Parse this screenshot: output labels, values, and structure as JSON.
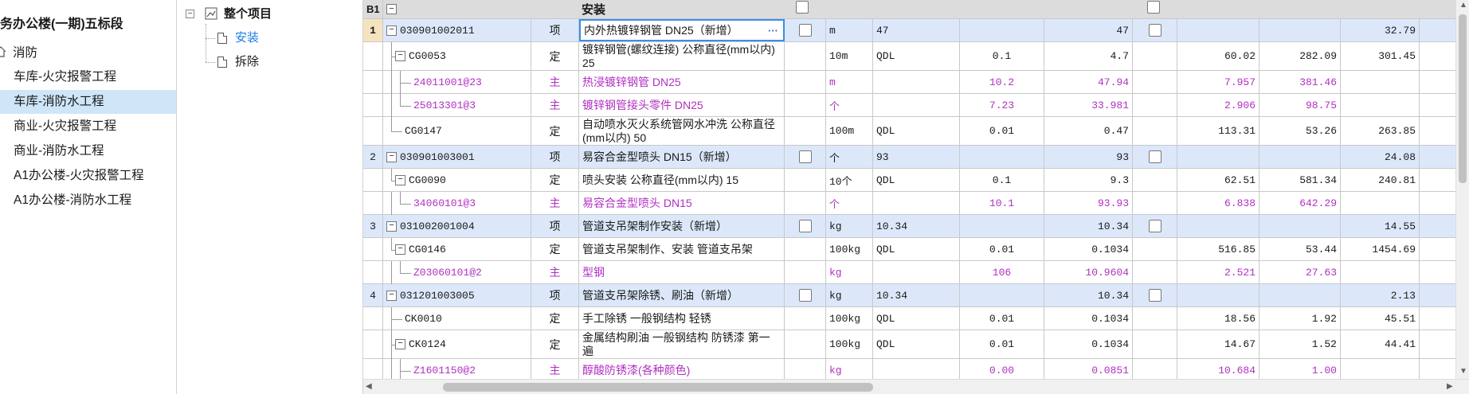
{
  "left_panel": {
    "project_title": "务办公楼(一期)五标段",
    "root": "消防",
    "items": [
      "车库-火灾报警工程",
      "车库-消防水工程",
      "商业-火灾报警工程",
      "商业-消防水工程",
      "A1办公楼-火灾报警工程",
      "A1办公楼-消防水工程"
    ],
    "selected_index": 1
  },
  "middle_panel": {
    "root": "整个项目",
    "children": [
      "安装",
      "拆除"
    ],
    "selected_index": 0,
    "expand_symbol": "−"
  },
  "grid": {
    "header": {
      "code": "B1",
      "name": "安装",
      "expand_symbol": "−"
    },
    "ellipsis": "···",
    "colors": {
      "accent_row": "#dce8fa",
      "header_bg": "#dcdcdc",
      "material_text": "#b030c0",
      "selected_tree": "#cfe6f8"
    },
    "rows": [
      {
        "idx": "1",
        "level": 0,
        "code": "030901002011",
        "type": "项",
        "name": "内外热镀锌钢管 DN25（新增）",
        "unit": "m",
        "expr": "47",
        "coef": "",
        "qty": "47",
        "p1": "",
        "p2": "",
        "p3": "32.79",
        "item": true,
        "hasBox": true,
        "selected": true
      },
      {
        "idx": "",
        "level": 1,
        "code": "CG0053",
        "type": "定",
        "name": "镀锌钢管(螺纹连接) 公称直径(mm以内) 25",
        "unit": "10m",
        "expr": "QDL",
        "coef": "0.1",
        "qty": "4.7",
        "p1": "60.02",
        "p2": "282.09",
        "p3": "301.45",
        "hasBox": true
      },
      {
        "idx": "",
        "level": 2,
        "code": "24011001@23",
        "type": "主",
        "name": "热浸镀锌钢管 DN25",
        "unit": "m",
        "expr": "",
        "coef": "10.2",
        "qty": "47.94",
        "p1": "7.957",
        "p2": "381.46",
        "p3": "",
        "mat": true
      },
      {
        "idx": "",
        "level": 2,
        "code": "25013301@3",
        "type": "主",
        "name": "镀锌钢管接头零件 DN25",
        "unit": "个",
        "expr": "",
        "coef": "7.23",
        "qty": "33.981",
        "p1": "2.906",
        "p2": "98.75",
        "p3": "",
        "mat": true,
        "last": true
      },
      {
        "idx": "",
        "level": 1,
        "code": "CG0147",
        "type": "定",
        "name": "自动喷水灭火系统管网水冲洗 公称直径(mm以内) 50",
        "unit": "100m",
        "expr": "QDL",
        "coef": "0.01",
        "qty": "0.47",
        "p1": "113.31",
        "p2": "53.26",
        "p3": "263.85",
        "last": true
      },
      {
        "idx": "2",
        "level": 0,
        "code": "030901003001",
        "type": "项",
        "name": "易容合金型喷头 DN15（新增）",
        "unit": "个",
        "expr": "93",
        "coef": "",
        "qty": "93",
        "p1": "",
        "p2": "",
        "p3": "24.08",
        "item": true,
        "hasBox": true
      },
      {
        "idx": "",
        "level": 1,
        "code": "CG0090",
        "type": "定",
        "name": "喷头安装 公称直径(mm以内) 15",
        "unit": "10个",
        "expr": "QDL",
        "coef": "0.1",
        "qty": "9.3",
        "p1": "62.51",
        "p2": "581.34",
        "p3": "240.81",
        "hasBox": true,
        "last": true
      },
      {
        "idx": "",
        "level": 2,
        "code": "34060101@3",
        "type": "主",
        "name": "易容合金型喷头 DN15",
        "unit": "个",
        "expr": "",
        "coef": "10.1",
        "qty": "93.93",
        "p1": "6.838",
        "p2": "642.29",
        "p3": "",
        "mat": true,
        "last": true
      },
      {
        "idx": "3",
        "level": 0,
        "code": "031002001004",
        "type": "项",
        "name": "管道支吊架制作安装（新增）",
        "unit": "kg",
        "expr": "10.34",
        "coef": "",
        "qty": "10.34",
        "p1": "",
        "p2": "",
        "p3": "14.55",
        "item": true,
        "hasBox": true
      },
      {
        "idx": "",
        "level": 1,
        "code": "CG0146",
        "type": "定",
        "name": "管道支吊架制作、安装 管道支吊架",
        "unit": "100kg",
        "expr": "QDL",
        "coef": "0.01",
        "qty": "0.1034",
        "p1": "516.85",
        "p2": "53.44",
        "p3": "1454.69",
        "hasBox": true,
        "last": true
      },
      {
        "idx": "",
        "level": 2,
        "code": "Z03060101@2",
        "type": "主",
        "name": "型钢",
        "unit": "kg",
        "expr": "",
        "coef": "106",
        "qty": "10.9604",
        "p1": "2.521",
        "p2": "27.63",
        "p3": "",
        "mat": true,
        "last": true
      },
      {
        "idx": "4",
        "level": 0,
        "code": "031201003005",
        "type": "项",
        "name": "管道支吊架除锈、刷油（新增）",
        "unit": "kg",
        "expr": "10.34",
        "coef": "",
        "qty": "10.34",
        "p1": "",
        "p2": "",
        "p3": "2.13",
        "item": true,
        "hasBox": true
      },
      {
        "idx": "",
        "level": 1,
        "code": "CK0010",
        "type": "定",
        "name": "手工除锈 一般钢结构 轻锈",
        "unit": "100kg",
        "expr": "QDL",
        "coef": "0.01",
        "qty": "0.1034",
        "p1": "18.56",
        "p2": "1.92",
        "p3": "45.51"
      },
      {
        "idx": "",
        "level": 1,
        "code": "CK0124",
        "type": "定",
        "name": "金属结构刷油 一般钢结构 防锈漆 第一遍",
        "unit": "100kg",
        "expr": "QDL",
        "coef": "0.01",
        "qty": "0.1034",
        "p1": "14.67",
        "p2": "1.52",
        "p3": "44.41",
        "hasBox": true
      },
      {
        "idx": "",
        "level": 2,
        "code": "Z1601150@2",
        "type": "主",
        "name": "醇酸防锈漆(各种颜色)",
        "unit": "kg",
        "expr": "",
        "coef": "0.00",
        "qty": "0.0851",
        "p1": "10.684",
        "p2": "1.00",
        "p3": "",
        "mat": true
      }
    ]
  }
}
